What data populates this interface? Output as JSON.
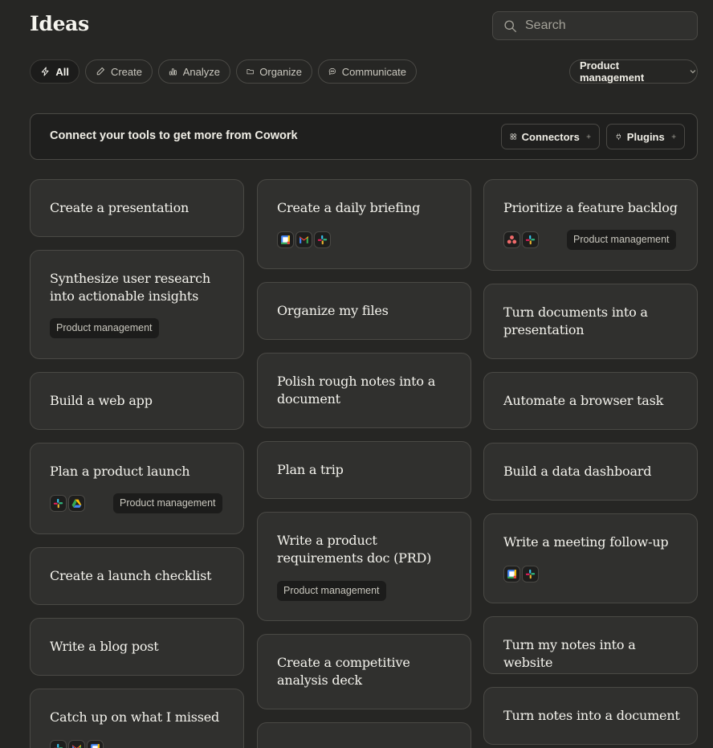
{
  "header": {
    "title": "Ideas"
  },
  "search": {
    "placeholder": "Search"
  },
  "filters": {
    "all": "All",
    "create": "Create",
    "analyze": "Analyze",
    "organize": "Organize",
    "communicate": "Communicate"
  },
  "dropdown": {
    "selected": "Product management"
  },
  "banner": {
    "text": "Connect your tools to get more from Cowork",
    "connectors_label": "Connectors",
    "plugins_label": "Plugins"
  },
  "cards": {
    "presentation": {
      "title": "Create a presentation"
    },
    "synthesize": {
      "title": "Synthesize user research into actionable insights",
      "tag": "Product management"
    },
    "web_app": {
      "title": "Build a web app"
    },
    "product_launch": {
      "title": "Plan a product launch",
      "tag": "Product management",
      "icons": [
        "slack-icon",
        "google-drive-icon"
      ]
    },
    "launch_checklist": {
      "title": "Create a launch checklist"
    },
    "blog_post": {
      "title": "Write a blog post"
    },
    "catch_up": {
      "title": "Catch up on what I missed",
      "icons": [
        "slack-icon",
        "gmail-icon",
        "google-calendar-icon"
      ]
    },
    "daily_briefing": {
      "title": "Create a daily briefing",
      "icons": [
        "google-calendar-icon",
        "gmail-icon",
        "slack-icon"
      ]
    },
    "organize_files": {
      "title": "Organize my files"
    },
    "polish_notes": {
      "title": "Polish rough notes into a document"
    },
    "plan_trip": {
      "title": "Plan a trip"
    },
    "prd": {
      "title": "Write a product requirements doc (PRD)",
      "tag": "Product management"
    },
    "competitive": {
      "title": "Create a competitive analysis deck"
    },
    "backlog": {
      "title": "Prioritize a feature backlog",
      "tag": "Product management",
      "icons": [
        "asana-icon",
        "slack-icon"
      ]
    },
    "docs_to_presentation": {
      "title": "Turn documents into a presentation"
    },
    "browser_task": {
      "title": "Automate a browser task"
    },
    "data_dashboard": {
      "title": "Build a data dashboard"
    },
    "meeting_followup": {
      "title": "Write a meeting follow-up",
      "icons": [
        "google-calendar-icon",
        "slack-icon"
      ]
    },
    "notes_website": {
      "title": "Turn my notes into a website"
    },
    "notes_document": {
      "title": "Turn notes into a document"
    }
  },
  "colors": {
    "background": "#262624",
    "card": "#30302e",
    "border": "#4a4945",
    "tag_background": "#1c1c1b",
    "text": "#f5f4ee",
    "muted_text": "#c9c7be"
  }
}
